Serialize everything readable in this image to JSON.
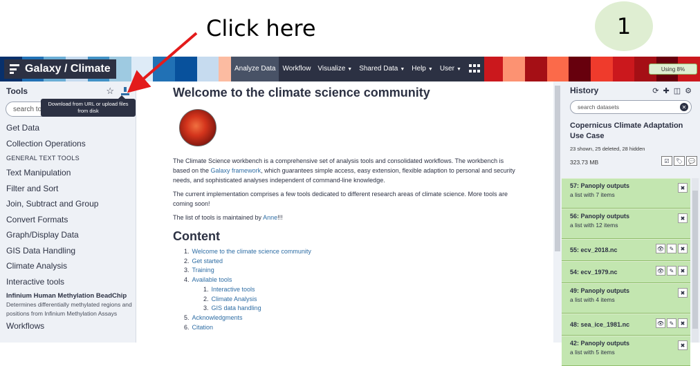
{
  "annotation": {
    "text": "Click here",
    "step": "1"
  },
  "header": {
    "brand": "Galaxy / Climate",
    "nav": [
      {
        "label": "Analyze Data",
        "caret": false
      },
      {
        "label": "Workflow",
        "caret": false
      },
      {
        "label": "Visualize",
        "caret": true
      },
      {
        "label": "Shared Data",
        "caret": true
      },
      {
        "label": "Help",
        "caret": true
      },
      {
        "label": "User",
        "caret": true
      }
    ],
    "quota": "Using 8%",
    "stripe_colors": [
      "#08306b",
      "#2171b5",
      "#6baed6",
      "#c6dbef",
      "#4292c6",
      "#9ecae1",
      "#deebf7",
      "#2171b5",
      "#08519c",
      "#c6dbef",
      "#fcbba1",
      "#6baed6",
      "#fee0d2",
      "#9ecae1",
      "#fc9272",
      "#c6dbef",
      "#deebf7",
      "#fb6a4a",
      "#fcbba1",
      "#ef3b2c",
      "#c6dbef",
      "#fee0d2",
      "#cb181d",
      "#fc9272",
      "#a50f15",
      "#fb6a4a",
      "#67000d",
      "#ef3b2c",
      "#cb181d",
      "#a50f15",
      "#67000d",
      "#cb181d"
    ]
  },
  "tools": {
    "title": "Tools",
    "search_placeholder": "search to",
    "tooltip": "Download from URL or upload files from disk",
    "items": [
      "Get Data",
      "Collection Operations"
    ],
    "section": "GENERAL TEXT TOOLS",
    "items2": [
      "Text Manipulation",
      "Filter and Sort",
      "Join, Subtract and Group",
      "Convert Formats",
      "Graph/Display Data",
      "GIS Data Handling",
      "Climate Analysis",
      "Interactive tools"
    ],
    "featured": {
      "title": "Infinium Human Methylation BeadChip",
      "desc": "Determines differentially methylated regions and positions from Infinium Methylation Assays"
    },
    "workflows": "Workflows"
  },
  "center": {
    "title": "Welcome to the climate science community",
    "p1_a": "The Climate Science workbench is a comprehensive set of analysis tools and consolidated workflows. The workbench is based on the ",
    "p1_link": "Galaxy framework",
    "p1_b": ", which guarantees simple access, easy extension, flexible adaption to personal and security needs, and sophisticated analyses independent of command-line knowledge.",
    "p2": "The current implementation comprises a few tools dedicated to different research areas of climate science. More tools are coming soon!",
    "p3_a": "The list of tools is maintained by ",
    "p3_link": "Anne",
    "p3_b": "!!!",
    "content_title": "Content",
    "toc": [
      {
        "num": "1.",
        "label": "Welcome to the climate science community",
        "sub": false
      },
      {
        "num": "2.",
        "label": "Get started",
        "sub": false
      },
      {
        "num": "3.",
        "label": "Training",
        "sub": false
      },
      {
        "num": "4.",
        "label": "Available tools",
        "sub": false
      },
      {
        "num": "1.",
        "label": "Interactive tools",
        "sub": true
      },
      {
        "num": "2.",
        "label": "Climate Analysis",
        "sub": true
      },
      {
        "num": "3.",
        "label": "GIS data handling",
        "sub": true
      },
      {
        "num": "5.",
        "label": "Acknowledgments",
        "sub": false
      },
      {
        "num": "6.",
        "label": "Citation",
        "sub": false
      }
    ]
  },
  "history": {
    "title": "History",
    "search_placeholder": "search datasets",
    "name": "Copernicus Climate Adaptation Use Case",
    "meta": "23 shown, 25 deleted, 28 hidden",
    "size": "323.73 MB",
    "datasets": [
      {
        "title": "57: Panoply outputs",
        "sub": "a list with 7 items",
        "actions": [
          "delete"
        ]
      },
      {
        "title": "56: Panoply outputs",
        "sub": "a list with 12 items",
        "actions": [
          "delete"
        ]
      },
      {
        "title": "55: ecv_2018.nc",
        "sub": "",
        "actions": [
          "view",
          "edit",
          "delete"
        ]
      },
      {
        "title": "54: ecv_1979.nc",
        "sub": "",
        "actions": [
          "view",
          "edit",
          "delete"
        ]
      },
      {
        "title": "49: Panoply outputs",
        "sub": "a list with 4 items",
        "actions": [
          "delete"
        ]
      },
      {
        "title": "48: sea_ice_1981.nc",
        "sub": "",
        "actions": [
          "view",
          "edit",
          "delete"
        ]
      },
      {
        "title": "42: Panoply outputs",
        "sub": "a list with 5 items",
        "actions": [
          "delete"
        ]
      }
    ]
  }
}
